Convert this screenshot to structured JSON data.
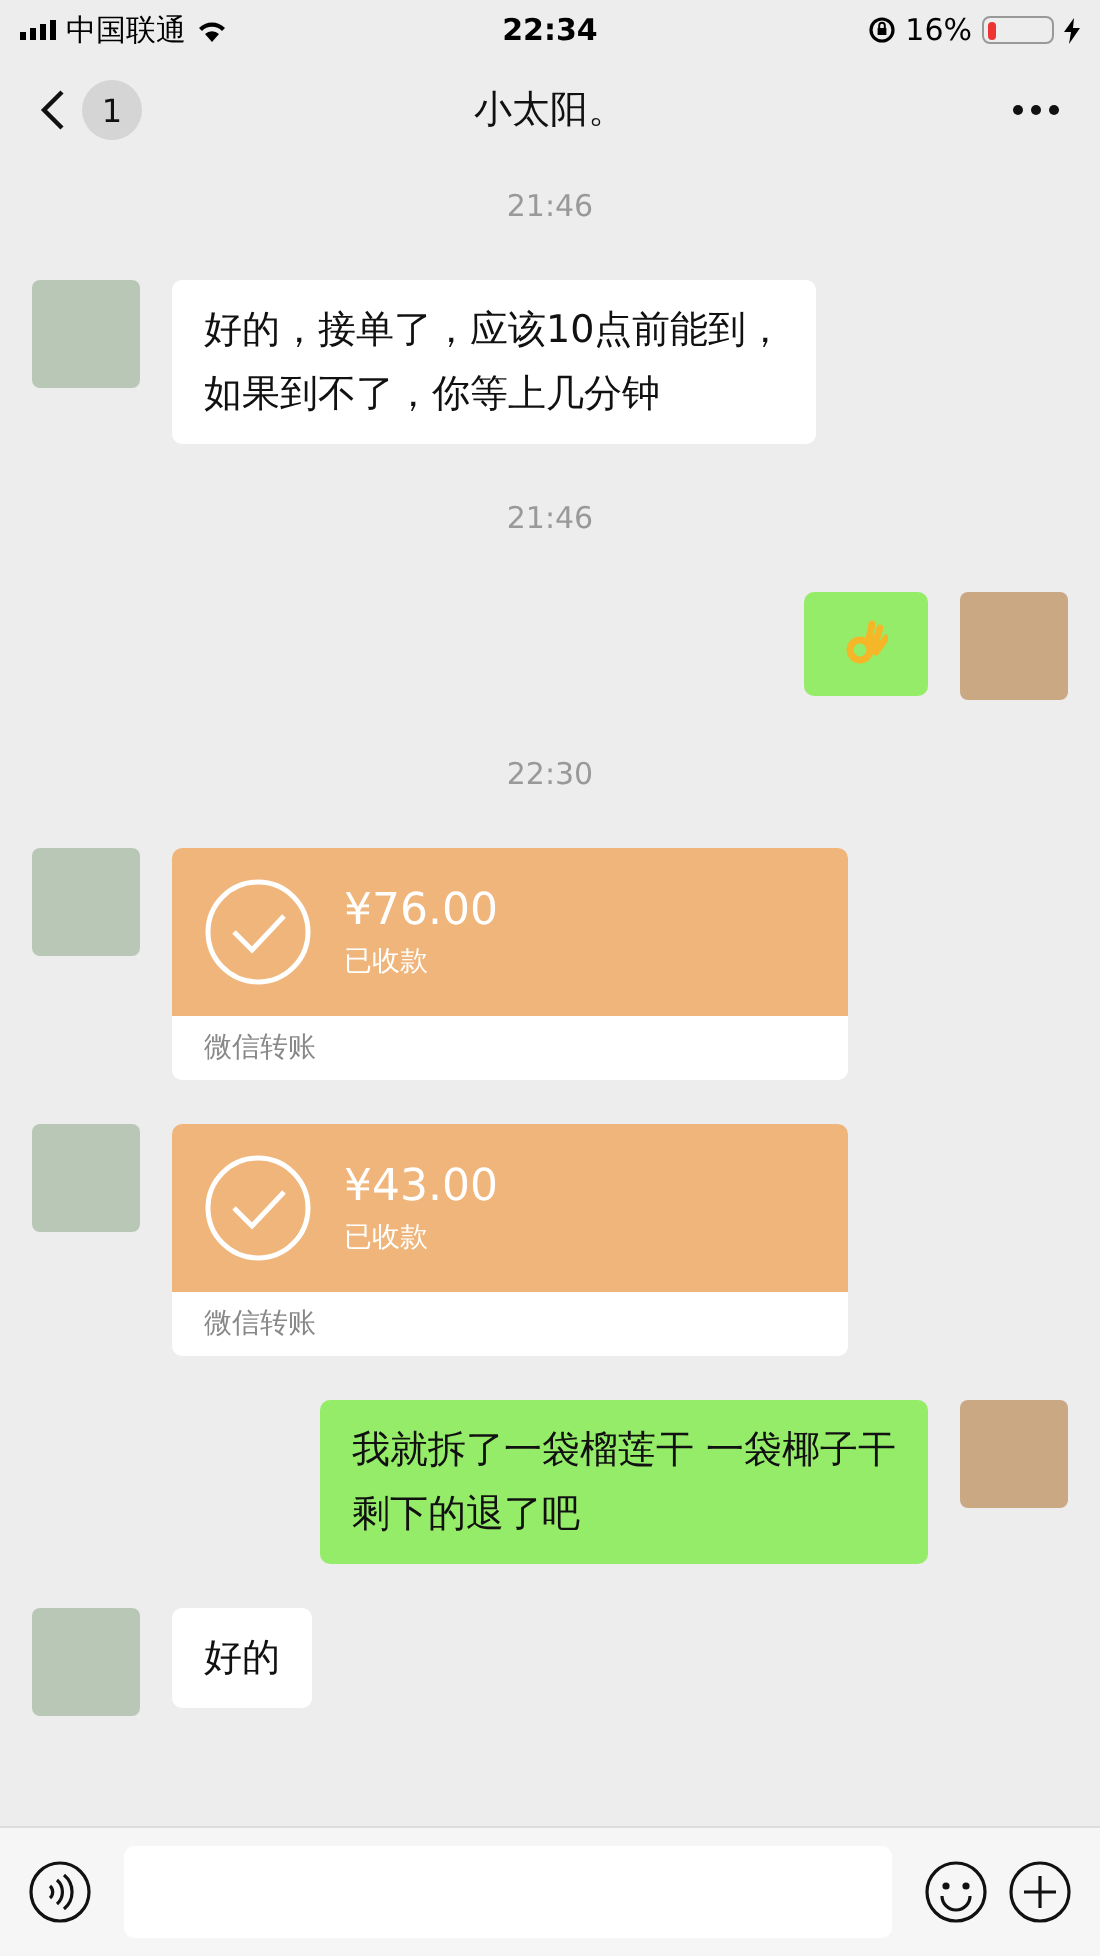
{
  "status_bar": {
    "carrier": "中国联通",
    "time": "22:34",
    "battery_text": "16%"
  },
  "nav": {
    "back_badge": "1",
    "title": "小太阳。"
  },
  "messages": [
    {
      "kind": "time",
      "text": "21:46"
    },
    {
      "kind": "text",
      "outgoing": false,
      "lines": [
        "好的，接单了，应该10点前能到，",
        "如果到不了，你等上几分钟"
      ]
    },
    {
      "kind": "time",
      "text": "21:46"
    },
    {
      "kind": "sticker",
      "outgoing": true
    },
    {
      "kind": "time",
      "text": "22:30"
    },
    {
      "kind": "transfer",
      "outgoing": false,
      "amount": "¥76.00",
      "status": "已收款",
      "received": true,
      "footer": "微信转账"
    },
    {
      "kind": "transfer",
      "outgoing": false,
      "amount": "¥43.00",
      "status": "已收款",
      "received": true,
      "footer": "微信转账"
    },
    {
      "kind": "text",
      "outgoing": true,
      "lines": [
        "我就拆了一袋榴莲干 一袋椰子干",
        "剩下的退了吧"
      ]
    },
    {
      "kind": "text",
      "outgoing": false,
      "lines": [
        "好的"
      ]
    }
  ]
}
